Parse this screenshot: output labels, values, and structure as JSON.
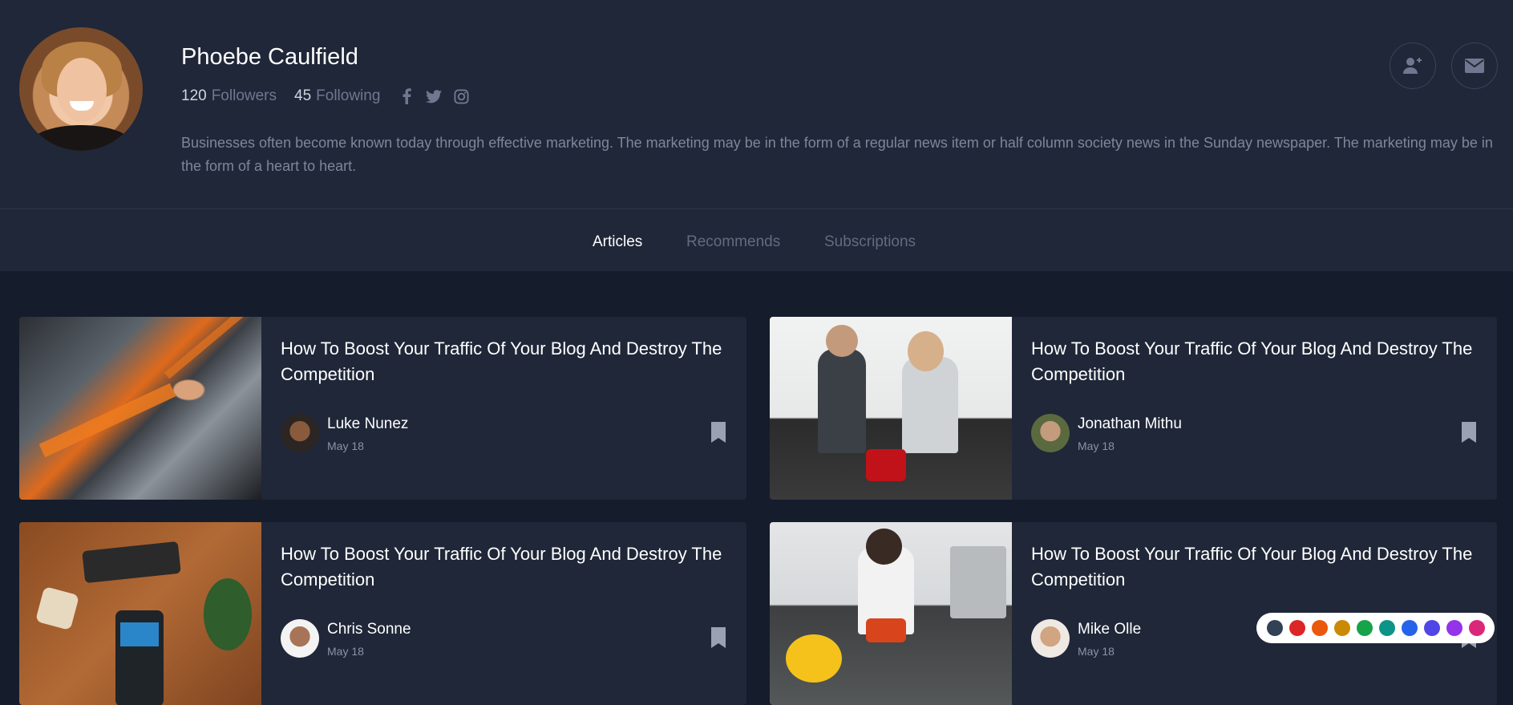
{
  "profile": {
    "name": "Phoebe Caulfield",
    "followers_count": "120",
    "followers_label": "Followers",
    "following_count": "45",
    "following_label": "Following",
    "bio": "Businesses often become known today through effective marketing. The marketing may be in the form of a regular news item or half column society news in the Sunday newspaper. The marketing may be in the form of a heart to heart.",
    "social_icons": [
      "facebook-icon",
      "twitter-icon",
      "instagram-icon"
    ],
    "actions": [
      "add-user-icon",
      "envelope-icon"
    ]
  },
  "tabs": [
    {
      "label": "Articles",
      "active": true
    },
    {
      "label": "Recommends",
      "active": false
    },
    {
      "label": "Subscriptions",
      "active": false
    }
  ],
  "articles": [
    {
      "title": "How To Boost Your Traffic Of Your Blog And Destroy The Competition",
      "author": "Luke Nunez",
      "date": "May 18"
    },
    {
      "title": "How To Boost Your Traffic Of Your Blog And Destroy The Competition",
      "author": "Jonathan Mithu",
      "date": "May 18"
    },
    {
      "title": "How To Boost Your Traffic Of Your Blog And Destroy The Competition",
      "author": "Chris Sonne",
      "date": "May 18"
    },
    {
      "title": "How To Boost Your Traffic Of Your Blog And Destroy The Competition",
      "author": "Mike Olle",
      "date": "May 18"
    }
  ],
  "theme_colors": [
    "#334155",
    "#dc2626",
    "#ea580c",
    "#ca8a04",
    "#16a34a",
    "#0d9488",
    "#2563eb",
    "#4f46e5",
    "#9333ea",
    "#db2777"
  ]
}
